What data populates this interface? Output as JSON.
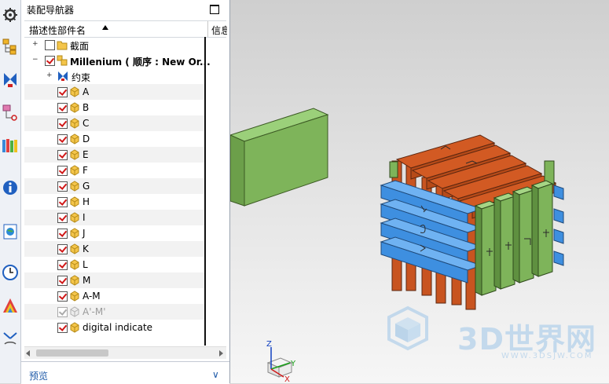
{
  "navigator": {
    "title": "装配导航器",
    "column_name": "描述性部件名",
    "column_info": "信息",
    "items": [
      {
        "label": "截面",
        "checked": false
      },
      {
        "label": "Millenium ( 顺序 : New Or...",
        "checked": true
      },
      {
        "label": "约束"
      },
      {
        "label": "A",
        "checked": true
      },
      {
        "label": "B",
        "checked": true
      },
      {
        "label": "C",
        "checked": true
      },
      {
        "label": "D",
        "checked": true
      },
      {
        "label": "E",
        "checked": true
      },
      {
        "label": "F",
        "checked": true
      },
      {
        "label": "G",
        "checked": true
      },
      {
        "label": "H",
        "checked": true
      },
      {
        "label": "I",
        "checked": true
      },
      {
        "label": "J",
        "checked": true
      },
      {
        "label": "K",
        "checked": true
      },
      {
        "label": "L",
        "checked": true
      },
      {
        "label": "M",
        "checked": true
      },
      {
        "label": "A-M",
        "checked": true
      },
      {
        "label": "A'-M'",
        "checked": true,
        "dimmed": true
      },
      {
        "label": "digital indicate",
        "checked": true
      }
    ],
    "preview_label": "预览"
  },
  "viewport": {
    "triad_labels": {
      "z": "Z",
      "y": "Y",
      "x": "X"
    },
    "watermark": {
      "text": "3D世界网",
      "url": "WWW.3DSJW.COM"
    }
  },
  "colors": {
    "orange_bar": "#d25a23",
    "blue_bar": "#3e8fe0",
    "green_bar": "#7eb45a",
    "accent": "#1e5aa8"
  }
}
